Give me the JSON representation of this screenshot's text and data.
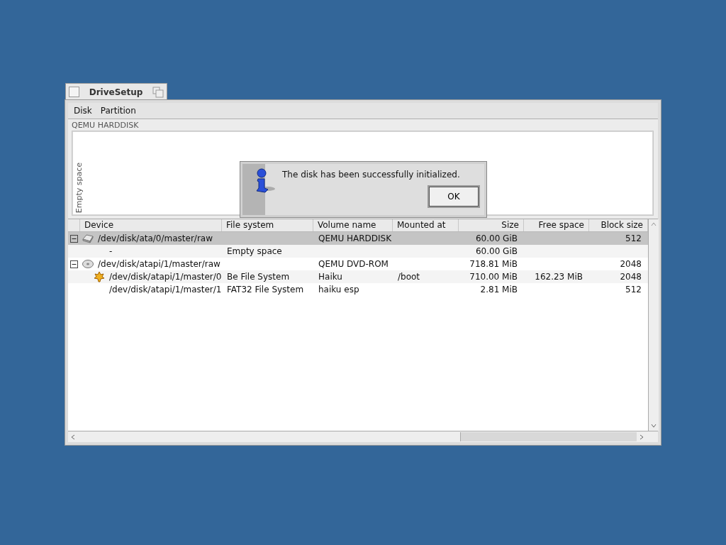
{
  "window": {
    "title": "DriveSetup"
  },
  "menu": [
    {
      "label": "Disk"
    },
    {
      "label": "Partition"
    }
  ],
  "disk_map": {
    "title": "QEMU HARDDISK",
    "segments": [
      {
        "label": "Empty space"
      }
    ]
  },
  "table": {
    "columns": [
      "Device",
      "File system",
      "Volume name",
      "Mounted at",
      "Size",
      "Free space",
      "Block size"
    ],
    "rows": [
      {
        "kind": "harddisk",
        "device": "/dev/disk/ata/0/master/raw",
        "volume_name": "QEMU HARDDISK",
        "size": "60.00 GiB",
        "block_size": "512",
        "selected": true,
        "expanded": true,
        "children": [
          {
            "kind": "none",
            "device": "-",
            "file_system": "Empty space",
            "size": "60.00 GiB",
            "selected": false
          }
        ]
      },
      {
        "kind": "cdrom",
        "device": "/dev/disk/atapi/1/master/raw",
        "volume_name": "QEMU DVD-ROM",
        "size": "718.81 MiB",
        "block_size": "2048",
        "selected": false,
        "expanded": true,
        "children": [
          {
            "kind": "leaf",
            "device": "/dev/disk/atapi/1/master/0",
            "file_system": "Be File System",
            "volume_name": "Haiku",
            "mounted_at": "/boot",
            "size": "710.00 MiB",
            "free_space": "162.23 MiB",
            "block_size": "2048",
            "selected": false
          },
          {
            "kind": "none",
            "device": "/dev/disk/atapi/1/master/1",
            "file_system": "FAT32 File System",
            "volume_name": "haiku esp",
            "size": "2.81 MiB",
            "block_size": "512",
            "selected": false
          }
        ]
      }
    ]
  },
  "dialog": {
    "message": "The disk has been successfully initialized.",
    "buttons": [
      "OK"
    ]
  }
}
